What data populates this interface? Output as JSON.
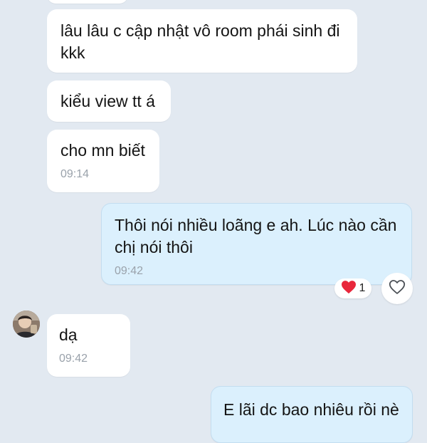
{
  "colors": {
    "background": "#e2e9f1",
    "incoming_bubble": "#ffffff",
    "outgoing_bubble": "#dbf0fd",
    "timestamp": "#9aa2ab",
    "reaction_heart": "#e8273b"
  },
  "messages": [
    {
      "direction": "incoming",
      "text": "lâu lâu c cập nhật vô room phái sinh đi\nkkk",
      "time": ""
    },
    {
      "direction": "incoming",
      "text": "kiểu view tt á",
      "time": ""
    },
    {
      "direction": "incoming",
      "text": "cho mn biết",
      "time": "09:14"
    },
    {
      "direction": "outgoing",
      "text": "Thôi nói nhiều loãng e ah. Lúc nào cần\nchị nói thôi",
      "time": "09:42",
      "reaction": {
        "icon": "heart-icon",
        "count": "1"
      }
    },
    {
      "direction": "incoming",
      "text": "dạ",
      "time": "09:42",
      "avatar": true
    },
    {
      "direction": "outgoing",
      "text": "E lãi dc bao nhiêu rồi nè",
      "time": ""
    }
  ]
}
